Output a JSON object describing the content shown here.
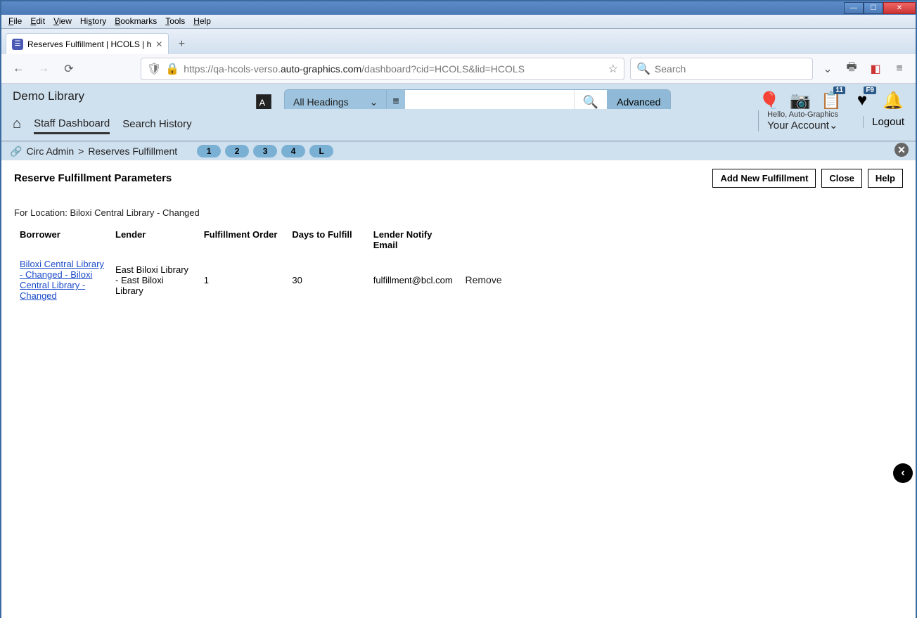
{
  "window": {
    "menus": [
      "File",
      "Edit",
      "View",
      "History",
      "Bookmarks",
      "Tools",
      "Help"
    ]
  },
  "tab": {
    "title": "Reserves Fulfillment | HCOLS | h"
  },
  "address": {
    "url_prefix": "https://qa-hcols-verso.",
    "url_bold": "auto-graphics.com",
    "url_suffix": "/dashboard?cid=HCOLS&lid=HCOLS",
    "search_placeholder": "Search"
  },
  "header": {
    "library": "Demo Library",
    "filter": "All Headings",
    "advanced": "Advanced",
    "badge_list": "11",
    "badge_fav": "F9"
  },
  "nav": {
    "home": "⌂",
    "staff": "Staff Dashboard",
    "history": "Search History",
    "hello": "Hello, Auto-Graphics",
    "account": "Your Account",
    "logout": "Logout"
  },
  "breadcrumb": {
    "a": "Circ Admin",
    "b": "Reserves Fulfillment",
    "pages": [
      "1",
      "2",
      "3",
      "4",
      "L"
    ]
  },
  "content": {
    "title": "Reserve Fulfillment Parameters",
    "add_btn": "Add New Fulfillment",
    "close_btn": "Close",
    "help_btn": "Help",
    "location_line": "For Location: Biloxi Central Library - Changed",
    "columns": {
      "borrower": "Borrower",
      "lender": "Lender",
      "order": "Fulfillment Order",
      "days": "Days to Fulfill",
      "email": "Lender Notify Email"
    },
    "row": {
      "borrower": "Biloxi Central Library - Changed - Biloxi Central Library - Changed",
      "lender": "East Biloxi Library - East Biloxi Library",
      "order": "1",
      "days": "30",
      "email": "fulfillment@bcl.com",
      "remove": "Remove"
    }
  }
}
